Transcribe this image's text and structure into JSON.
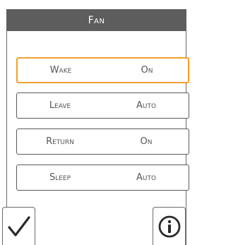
{
  "header": {
    "title": "Fan"
  },
  "rows": [
    {
      "mode": "Wake",
      "value": "On",
      "selected": true
    },
    {
      "mode": "Leave",
      "value": "Auto",
      "selected": false
    },
    {
      "mode": "Return",
      "value": "On",
      "selected": false
    },
    {
      "mode": "Sleep",
      "value": "Auto",
      "selected": false
    }
  ],
  "buttons": {
    "confirm_icon": "checkmark-icon",
    "info_icon": "info-icon"
  },
  "colors": {
    "title_bar": "#5d5d5d",
    "selected_border": "#f0a030",
    "border": "#5a5a5a"
  }
}
